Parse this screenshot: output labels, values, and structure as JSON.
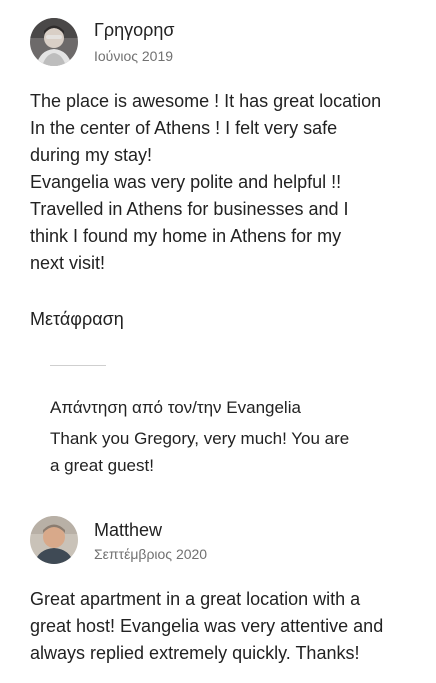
{
  "reviews": [
    {
      "reviewer_name": "Γρηγορησ",
      "date": "Ιούνιος 2019",
      "avatar_icon": "user-photo-icon",
      "body_lines": [
        "The place is awesome ! It has great location",
        "In the center of Athens ! I felt very safe",
        "during my stay!",
        "Evangelia was very polite and helpful !!",
        "Travelled in Athens for businesses and I",
        "think  I found my home in Athens for my",
        "next visit!"
      ],
      "translate_label": "Μετάφραση",
      "host_response": {
        "title": "Απάντηση από τον/την Evangelia",
        "body_lines": [
          "Thank you Gregory, very much! You are",
          "a great guest!"
        ]
      }
    },
    {
      "reviewer_name": "Matthew",
      "date": "Σεπτέμβριος 2020",
      "avatar_icon": "user-photo-icon",
      "body_lines": [
        "Great apartment in a great location with a",
        "great host! Evangelia was very attentive and",
        "always replied extremely quickly. Thanks!"
      ]
    }
  ]
}
